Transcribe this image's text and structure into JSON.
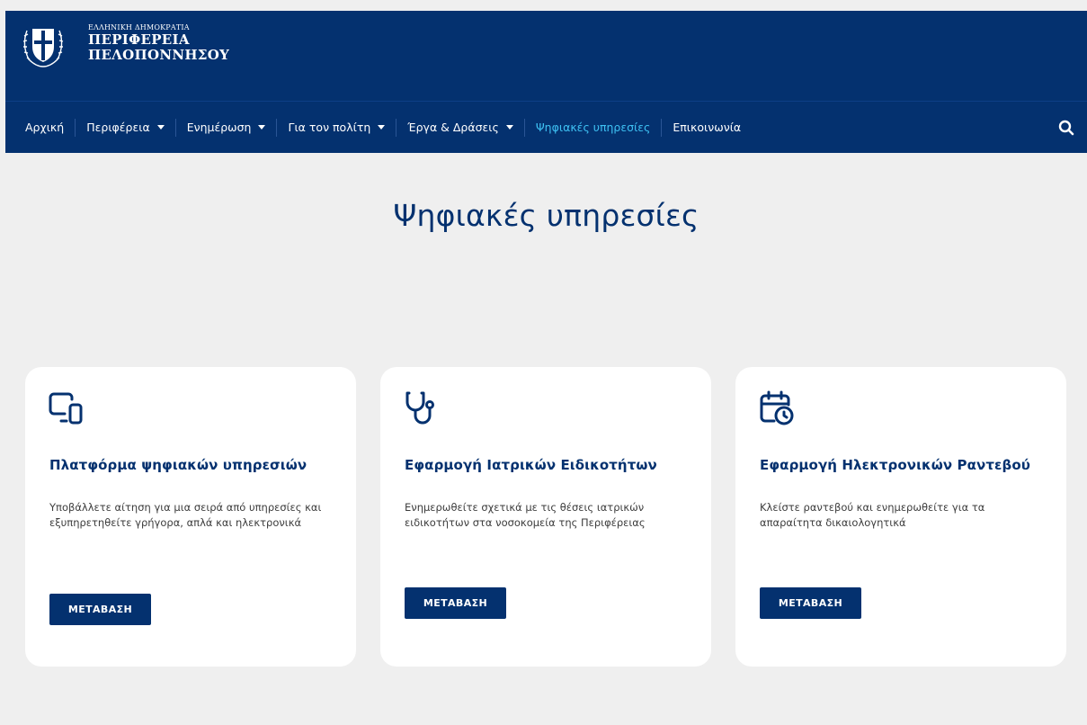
{
  "header": {
    "brand_small": "ΕΛΛΗΝΙΚΗ ΔΗΜΟΚΡΑΤΙΑ",
    "brand_line1": "ΠΕΡΙΦΕΡΕΙΑ",
    "brand_line2": "ΠΕΛΟΠΟΝΝΗΣΟΥ",
    "emblem_icon": "greek-coat-of-arms-icon"
  },
  "nav": {
    "items": [
      {
        "label": "Αρχική",
        "has_dropdown": false
      },
      {
        "label": "Περιφέρεια",
        "has_dropdown": true
      },
      {
        "label": "Ενημέρωση",
        "has_dropdown": true
      },
      {
        "label": "Για τον πολίτη",
        "has_dropdown": true
      },
      {
        "label": "Έργα & Δράσεις",
        "has_dropdown": true
      },
      {
        "label": "Ψηφιακές υπηρεσίες",
        "has_dropdown": false,
        "active": true
      },
      {
        "label": "Επικοινωνία",
        "has_dropdown": false
      }
    ],
    "search_icon": "search-icon"
  },
  "main": {
    "title": "Ψηφιακές υπηρεσίες",
    "cards": [
      {
        "icon": "devices-icon",
        "title": "Πλατφόρμα ψηφιακών υπηρεσιών",
        "description": "Υποβάλλετε αίτηση για μια σειρά από υπηρεσίες και εξυπηρετηθείτε γρήγορα, απλά και ηλεκτρονικά",
        "button_label": "ΜΕΤΑΒΑΣΗ"
      },
      {
        "icon": "stethoscope-icon",
        "title": "Εφαρμογή Ιατρικών Ειδικοτήτων",
        "description": "Ενημερωθείτε σχετικά με τις θέσεις ιατρικών ειδικοτήτων στα νοσοκομεία της Περιφέρειας",
        "button_label": "ΜΕΤΑΒΑΣΗ"
      },
      {
        "icon": "calendar-clock-icon",
        "title": "Εφαρμογή Ηλεκτρονικών Ραντεβού",
        "description": "Κλείστε ραντεβού και ενημερωθείτε για τα απαραίτητα δικαιολογητικά",
        "button_label": "ΜΕΤΑΒΑΣΗ"
      }
    ]
  },
  "colors": {
    "brand_navy": "#04316f",
    "active_link": "#3ec1f3",
    "page_bg": "#efefef",
    "card_bg": "#ffffff"
  }
}
